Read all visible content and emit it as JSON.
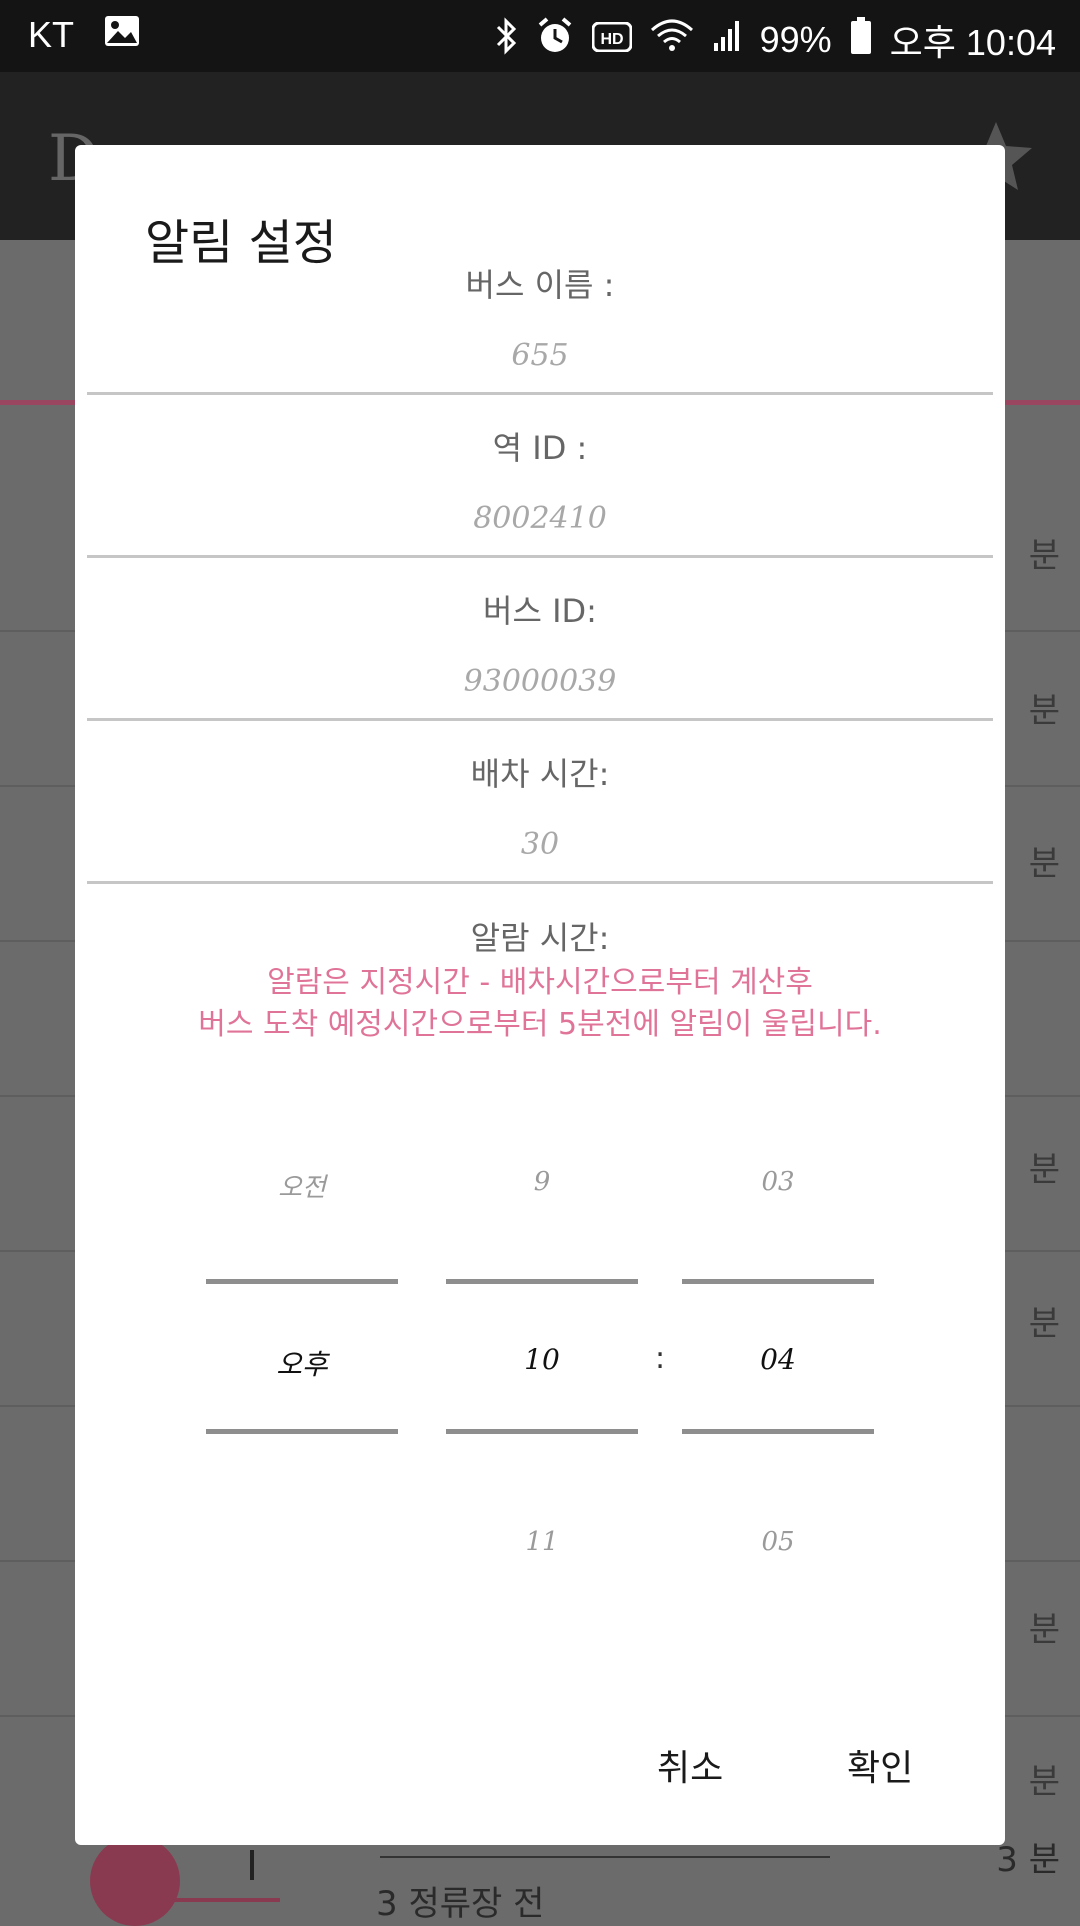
{
  "status_bar": {
    "carrier": "KT",
    "battery": "99%",
    "time": "오후 10:04"
  },
  "background": {
    "title": "D",
    "rows_min_label": "분",
    "bottom_stop_text": "3 정류장 전",
    "bottom_min_text": "3 분"
  },
  "dialog": {
    "title": "알림 설정",
    "fields": [
      {
        "label": "버스 이름 :",
        "value": "655"
      },
      {
        "label": "역 ID :",
        "value": "8002410"
      },
      {
        "label": "버스 ID:",
        "value": "93000039"
      },
      {
        "label": "배차 시간:",
        "value": "30"
      }
    ],
    "alarm_label": "알람 시간:",
    "alarm_note_line1": "알람은 지정시간 - 배차시간으로부터 계산후",
    "alarm_note_line2": "버스 도착 예정시간으로부터 5분전에 알림이 울립니다.",
    "picker": {
      "ampm": {
        "above": "오전",
        "selected": "오후",
        "below": ""
      },
      "hour": {
        "above": "9",
        "selected": "10",
        "below": "11"
      },
      "minute": {
        "above": "03",
        "selected": "04",
        "below": "05"
      },
      "separator": ":"
    },
    "cancel_label": "취소",
    "confirm_label": "확인"
  }
}
